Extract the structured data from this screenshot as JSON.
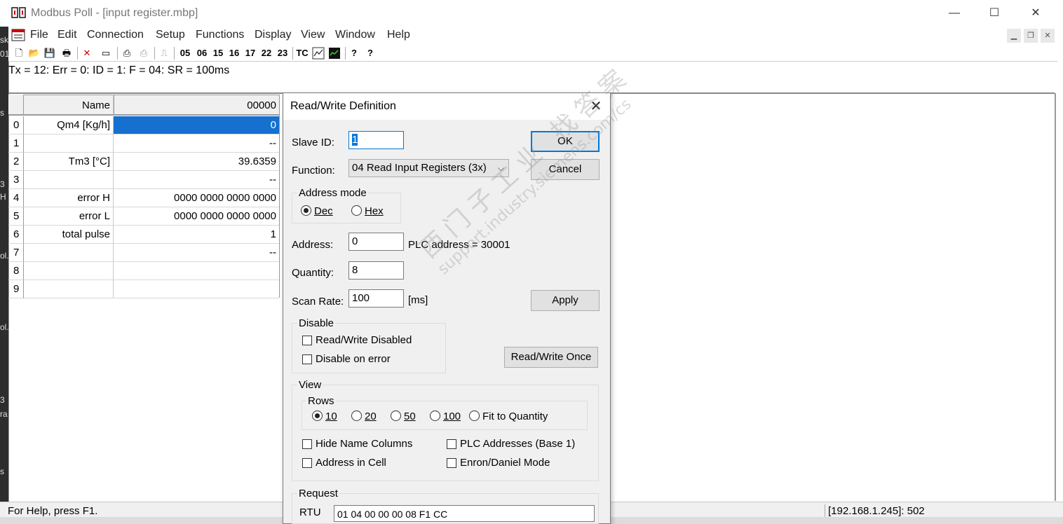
{
  "window": {
    "title": "Modbus Poll - [input register.mbp]",
    "minimize": "—",
    "maximize": "☐",
    "close": "✕"
  },
  "menu": {
    "items": [
      "File",
      "Edit",
      "Connection",
      "Setup",
      "Functions",
      "Display",
      "View",
      "Window",
      "Help"
    ],
    "mdi_min": "▁",
    "mdi_restore": "❐",
    "mdi_close": "✕"
  },
  "toolbar": {
    "new": "🗋",
    "open": "📂",
    "save": "💾",
    "print": "🖶",
    "delete": "✕",
    "window": "▭",
    "connect": "⎙",
    "disconnect": "⎙",
    "pulse": "⎍",
    "func_codes": [
      "05",
      "06",
      "15",
      "16",
      "17",
      "22",
      "23"
    ],
    "tc": "TC",
    "help": "?",
    "whatsthis": "?"
  },
  "left_strip": [
    "sk",
    "01",
    "s",
    "3",
    "H",
    "ol.",
    "ol.",
    "3",
    "ra",
    "s"
  ],
  "status_line": "Tx = 12: Err = 0: ID = 1: F = 04: SR = 100ms",
  "grid": {
    "header": {
      "name": "Name",
      "value": "00000"
    },
    "rows": [
      {
        "idx": "0",
        "name": "Qm4 [Kg/h]",
        "value": "0"
      },
      {
        "idx": "1",
        "name": "",
        "value": "--"
      },
      {
        "idx": "2",
        "name": "Tm3 [°C]",
        "value": "39.6359"
      },
      {
        "idx": "3",
        "name": "",
        "value": "--"
      },
      {
        "idx": "4",
        "name": "error  H",
        "value": "0000 0000 0000 0000"
      },
      {
        "idx": "5",
        "name": "error  L",
        "value": "0000 0000 0000 0000"
      },
      {
        "idx": "6",
        "name": "total pulse",
        "value": "1"
      },
      {
        "idx": "7",
        "name": "",
        "value": "--"
      },
      {
        "idx": "8",
        "name": "",
        "value": ""
      },
      {
        "idx": "9",
        "name": "",
        "value": ""
      }
    ]
  },
  "statusbar": {
    "help": "For Help, press F1.",
    "connection": "[192.168.1.245]: 502"
  },
  "dialog": {
    "title": "Read/Write Definition",
    "close": "✕",
    "slave_id": {
      "label": "Slave ID:",
      "value": "1"
    },
    "function": {
      "label": "Function:",
      "value": "04 Read Input Registers (3x)"
    },
    "address_mode": {
      "label": "Address mode",
      "dec": "Dec",
      "hex": "Hex",
      "selected": "Dec"
    },
    "address": {
      "label": "Address:",
      "value": "0",
      "plc": "PLC address = 30001"
    },
    "quantity": {
      "label": "Quantity:",
      "value": "8"
    },
    "scan_rate": {
      "label": "Scan Rate:",
      "value": "100",
      "unit": "[ms]"
    },
    "buttons": {
      "ok": "OK",
      "cancel": "Cancel",
      "apply": "Apply",
      "rw_once": "Read/Write Once"
    },
    "disable": {
      "label": "Disable",
      "rw_disabled": "Read/Write Disabled",
      "on_error": "Disable on error"
    },
    "view": {
      "label": "View",
      "rows_label": "Rows",
      "rows": [
        "10",
        "20",
        "50",
        "100",
        "Fit to Quantity"
      ],
      "rows_selected": "10",
      "hide_name": "Hide Name Columns",
      "plc_addresses": "PLC Addresses (Base 1)",
      "address_in_cell": "Address in Cell",
      "enron": "Enron/Daniel Mode"
    },
    "request": {
      "label": "Request",
      "rtu_label": "RTU",
      "rtu_value": "01 04 00 00 00 08 F1 CC"
    }
  },
  "watermark": {
    "line1": "西门子工业  找答案",
    "line2": "support.industry.siemens.com/cs"
  },
  "colors": {
    "selection": "#1570d0",
    "focus": "#0078d7",
    "dialog_bg": "#f0f0f0"
  }
}
